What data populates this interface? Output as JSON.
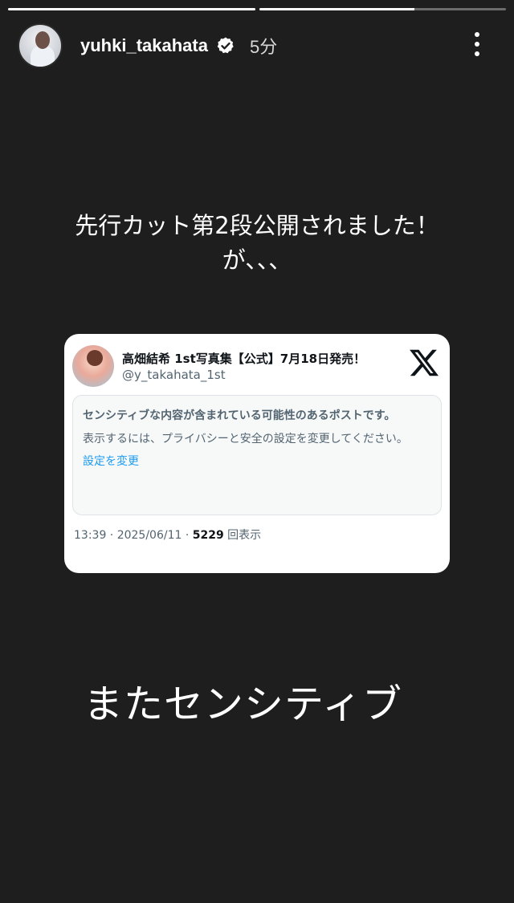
{
  "progress": [
    1.0,
    0.63
  ],
  "header": {
    "username": "yuhki_takahata",
    "time": "5分"
  },
  "caption": {
    "line1": "先行カット第2段公開されました！",
    "line2": "が、、、"
  },
  "tweet": {
    "name": "高畑結希 1st写真集【公式】7月18日発売！",
    "handle": "@y_takahata_1st",
    "notice_title": "センシティブな内容が含まれている可能性のあるポストです。",
    "notice_body": "表示するには、プライバシーと安全の設定を変更してください。",
    "notice_link": "設定を変更",
    "meta_time": "13:39 · 2025/06/11 · ",
    "meta_views": "5229",
    "meta_views_label": " 回表示"
  },
  "bottom_text": "またセンシティブ",
  "colors": {
    "background": "#1e1e1e",
    "link": "#1d9bf0",
    "verified_badge": "#ffffff"
  },
  "icons": [
    "more-vertical-icon",
    "verified-badge-icon",
    "x-logo-icon"
  ]
}
